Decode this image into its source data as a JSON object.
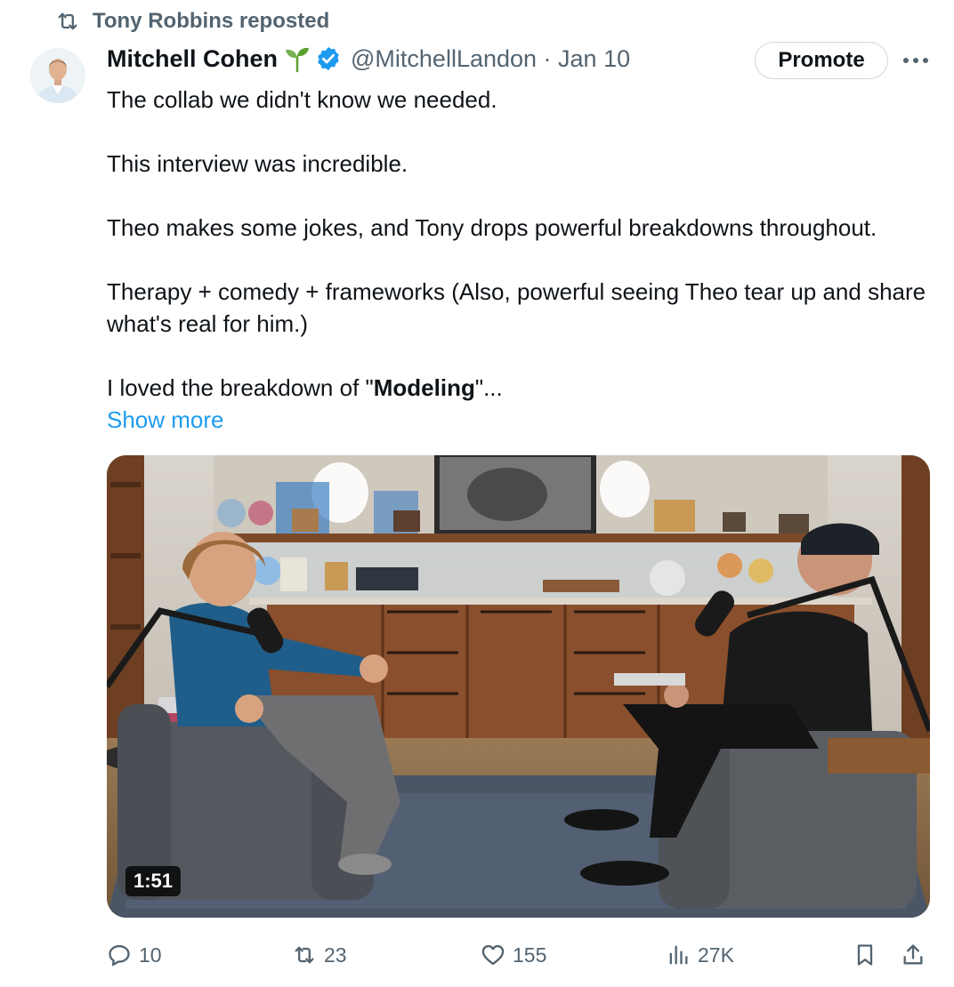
{
  "repost": {
    "label": "Tony Robbins reposted",
    "icon": "repost-icon"
  },
  "author": {
    "name": "Mitchell Cohen",
    "emoji_icon": "sprout-icon",
    "verified_icon": "verified-badge-icon",
    "handle_date": "@MitchellLandon · Jan 10"
  },
  "promote_label": "Promote",
  "more_icon": "more-options-icon",
  "text": {
    "p1": "The collab we didn't know we needed.",
    "p2": "This interview was incredible.",
    "p3": "Theo makes some jokes, and Tony drops powerful breakdowns throughout.",
    "p4": "Therapy + comedy + frameworks (Also, powerful seeing Theo tear up and share what's real for him.)",
    "p5_before": "I loved the breakdown of \"",
    "p5_bold": "Modeling",
    "p5_after": "\"..."
  },
  "show_more": "Show more",
  "video": {
    "duration": "1:51"
  },
  "actions": {
    "replies": "10",
    "reposts": "23",
    "likes": "155",
    "views": "27K"
  },
  "colors": {
    "text": "#0f1419",
    "secondary": "#536471",
    "accent": "#1d9bf0",
    "verified": "#1d9bf0",
    "sprout": "#5aa02c"
  }
}
